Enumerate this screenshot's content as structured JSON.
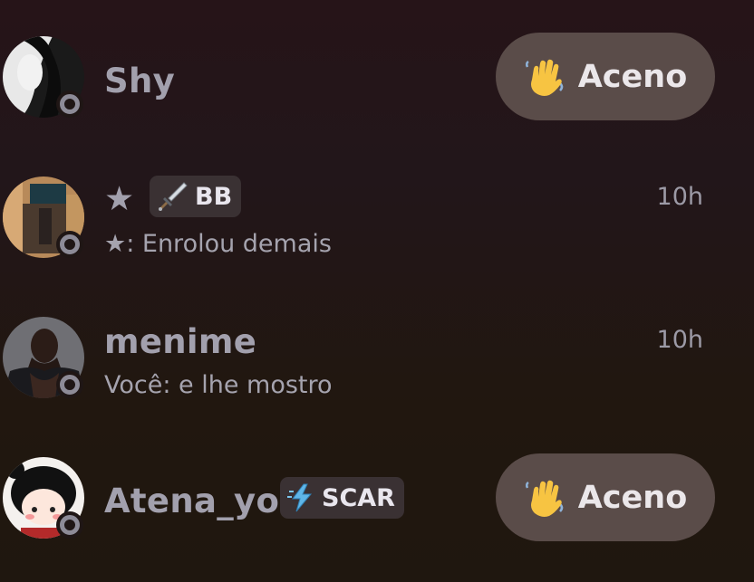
{
  "conversations": [
    {
      "name": "Shy",
      "status_icon": "offline-status-icon",
      "action": {
        "label": "Aceno",
        "icon": "waving-hand-icon"
      }
    },
    {
      "name": "★",
      "tag": {
        "label": "BB",
        "icon": "sword-icon"
      },
      "preview": "★: Enrolou demais",
      "time": "10h",
      "status_icon": "offline-status-icon"
    },
    {
      "name": "menime",
      "preview": "Você: e lhe mostro",
      "time": "10h",
      "status_icon": "offline-status-icon"
    },
    {
      "name": "Atena_yo",
      "tag": {
        "label": "SCAR",
        "icon": "lightning-icon"
      },
      "status_icon": "offline-status-icon",
      "action": {
        "label": "Aceno",
        "icon": "waving-hand-icon"
      }
    }
  ]
}
